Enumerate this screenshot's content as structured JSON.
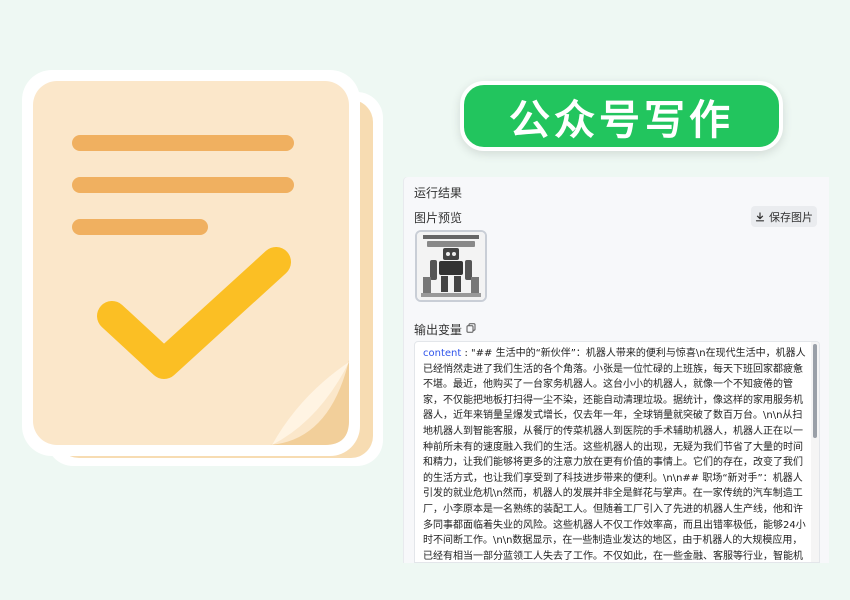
{
  "badge": {
    "title": "公众号写作"
  },
  "panel": {
    "run_result_title": "运行结果",
    "image_preview_title": "图片预览",
    "save_image_label": "保存图片",
    "output_vars_title": "输出变量",
    "content_key": "content",
    "content_sep": " : ",
    "content_value": "\"## 生活中的“新伙伴”：机器人带来的便利与惊喜\\n在现代生活中，机器人已经悄然走进了我们生活的各个角落。小张是一位忙碌的上班族，每天下班回家都疲惫不堪。最近，他购买了一台家务机器人。这台小小的机器人，就像一个不知疲倦的管家，不仅能把地板打扫得一尘不染，还能自动清理垃圾。据统计，像这样的家用服务机器人，近年来销量呈爆发式增长，仅去年一年，全球销量就突破了数百万台。\\n\\n从扫地机器人到智能客服，从餐厅的传菜机器人到医院的手术辅助机器人，机器人正在以一种前所未有的速度融入我们的生活。这些机器人的出现，无疑为我们节省了大量的时间和精力，让我们能够将更多的注意力放在更有价值的事情上。它们的存在，改变了我们的生活方式，也让我们享受到了科技进步带来的便利。\\n\\n## 职场“新对手”：机器人引发的就业危机\\n然而，机器人的发展并非全是鲜花与掌声。在一家传统的汽车制造工厂，小李原本是一名熟练的装配工人。但随着工厂引入了先进的机器人生产线，他和许多同事都面临着失业的风险。这些机器人不仅工作效率高，而且出错率极低，能够24小时不间断工作。\\n\\n数据显示，在一些制造业发达的地区，由于机器人的大规模应用，已经有相当一部分蓝领工人失去了工作。不仅如此，在一些金融、客服等行业，智能机器人也开始逐渐取代人类。曾经需要大量人工处理的繁琐业务，现在一台智能机器人就能轻松应对。这无疑引发了人们对就业的担忧，人类与机器人在职场的竞争似乎已经不可避免。\\n\\n## 伦理困境：机器人引发的思考\\n随着机器人越来越智能化，它们所引发的伦理问题也日益凸显。设想一下，如果"
  },
  "colors": {
    "page_bg": "#eef8f3",
    "badge_green": "#22c55e",
    "paper": "#fbe6c8",
    "line_orange": "#f0b060",
    "check_yellow": "#fbbf24",
    "content_key_blue": "#2f54eb"
  }
}
